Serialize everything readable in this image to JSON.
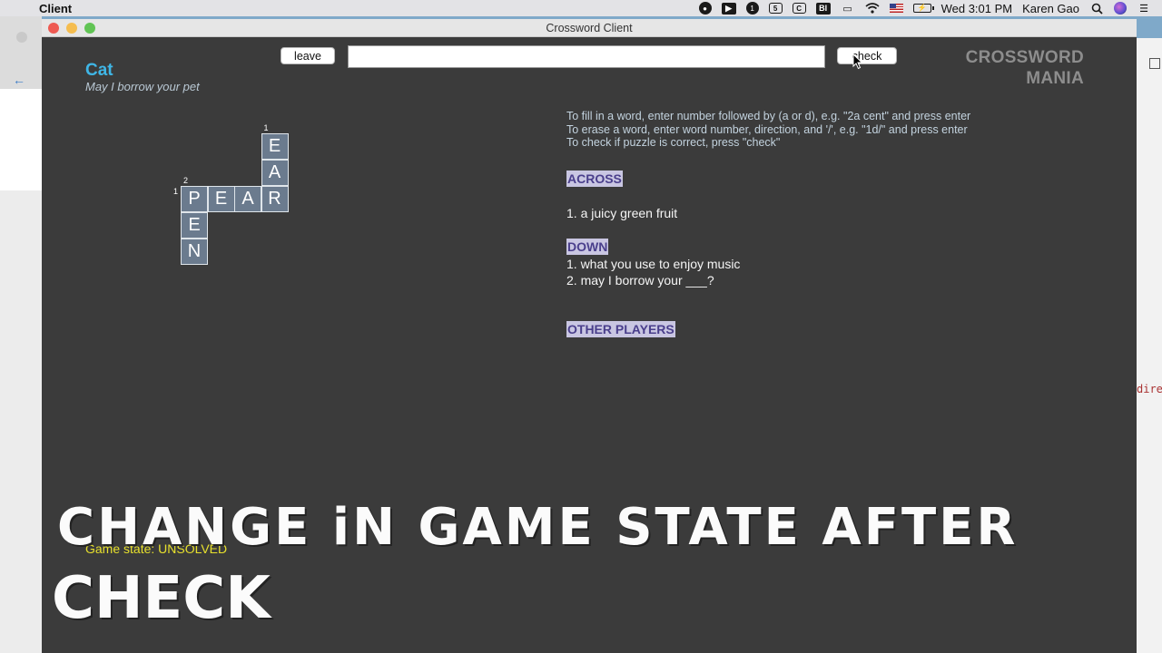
{
  "menubar": {
    "apple_glyph": "",
    "app_name": "Client",
    "icons": [
      "record-icon",
      "zoom-icon",
      "1password-icon",
      "5-icon",
      "c-icon",
      "bi-icon",
      "airplay-icon",
      "wifi-icon",
      "us-flag-icon",
      "battery-icon"
    ],
    "clock": "Wed 3:01 PM",
    "user": "Karen Gao"
  },
  "window": {
    "title": "Crossword Client"
  },
  "toolbar": {
    "leave_label": "leave",
    "check_label": "check",
    "input_value": ""
  },
  "logo": {
    "line1": "CROSSWORD",
    "line2": "MANIA"
  },
  "puzzle": {
    "title": "Cat",
    "subtitle": "May I borrow your pet",
    "cells": [
      {
        "letter": "E",
        "row": 0,
        "col": 3
      },
      {
        "letter": "A",
        "row": 1,
        "col": 3
      },
      {
        "letter": "P",
        "row": 2,
        "col": 0
      },
      {
        "letter": "E",
        "row": 2,
        "col": 1
      },
      {
        "letter": "A",
        "row": 2,
        "col": 2
      },
      {
        "letter": "R",
        "row": 2,
        "col": 3
      },
      {
        "letter": "E",
        "row": 3,
        "col": 0
      },
      {
        "letter": "N",
        "row": 4,
        "col": 0
      }
    ],
    "numbers": [
      {
        "label": "1",
        "row": 0,
        "col": 3,
        "pos": "top"
      },
      {
        "label": "2",
        "row": 2,
        "col": 0,
        "pos": "top"
      },
      {
        "label": "1",
        "row": 2,
        "col": 0,
        "pos": "left"
      }
    ]
  },
  "instructions": [
    "To fill in a word, enter number followed by (a or d), e.g. \"2a cent\"  and press enter",
    "To erase a word, enter word number, direction, and '/', e.g. \"1d/\" and press enter",
    "To check if puzzle is correct, press \"check\""
  ],
  "across": {
    "heading": "ACROSS",
    "clues": [
      "1. a juicy green fruit"
    ]
  },
  "down": {
    "heading": "DOWN",
    "clues": [
      "1. what you use to enjoy music",
      "2. may I borrow your ___?"
    ]
  },
  "other_players": {
    "heading": "OTHER PLAYERS"
  },
  "game_state": "Game state: UNSOLVED",
  "caption": {
    "line1": "CHANGE iN GAME STATE AFTER",
    "line2": "CHECK"
  },
  "bg_code_fragment": "dire"
}
